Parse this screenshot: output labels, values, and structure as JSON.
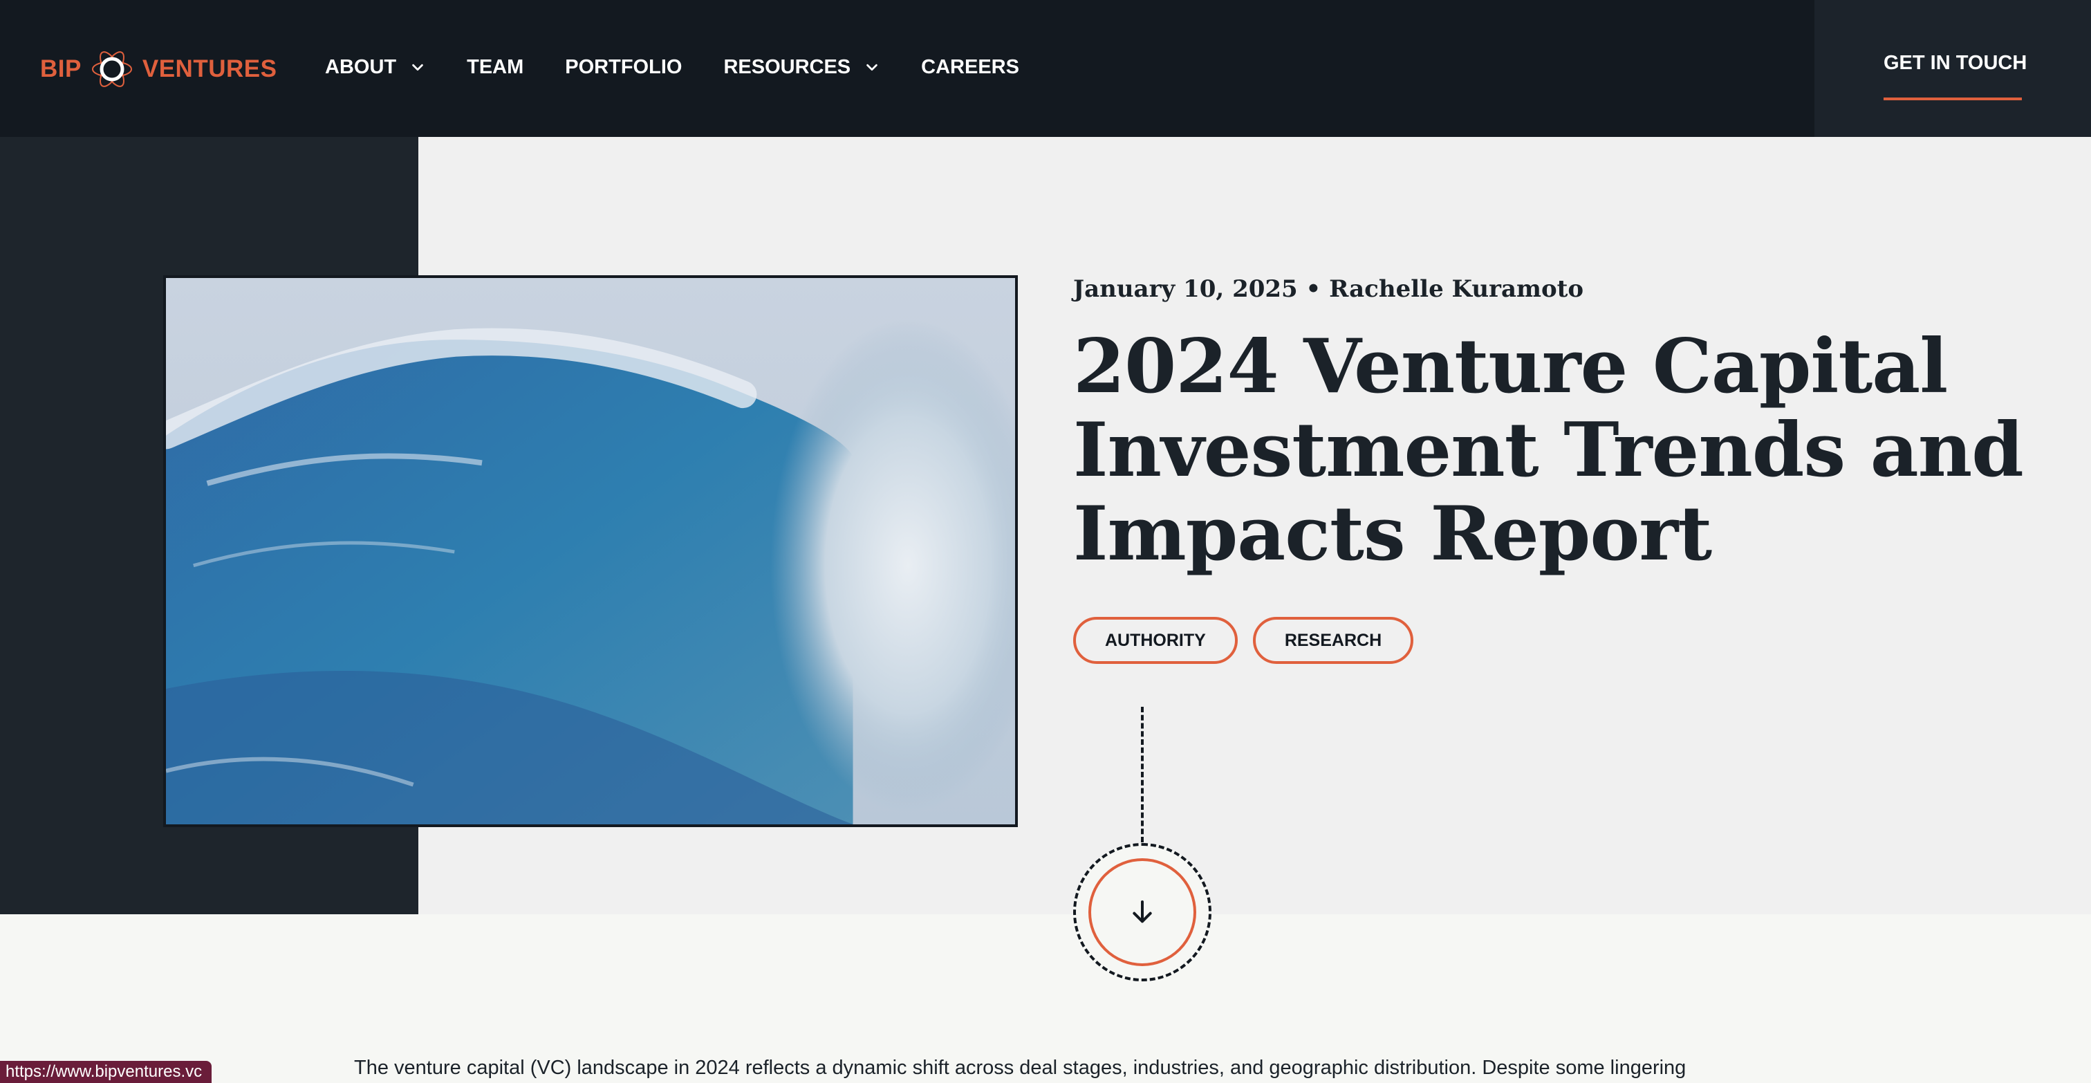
{
  "header": {
    "logo": {
      "left_text": "BIP",
      "right_text": "VENTURES"
    },
    "nav": [
      {
        "label": "ABOUT",
        "has_dropdown": true
      },
      {
        "label": "TEAM",
        "has_dropdown": false
      },
      {
        "label": "PORTFOLIO",
        "has_dropdown": false
      },
      {
        "label": "RESOURCES",
        "has_dropdown": true
      },
      {
        "label": "CAREERS",
        "has_dropdown": false
      }
    ],
    "cta_label": "GET IN TOUCH"
  },
  "hero": {
    "meta": "January 10, 2025 • Rachelle Kuramoto",
    "title": "2024 Venture Capital Investment Trends and Impacts Report",
    "tags": [
      "AUTHORITY",
      "RESEARCH"
    ],
    "image_icon": "ocean-wave-photo",
    "scroll_icon": "arrow-down-icon"
  },
  "body": {
    "intro": "The venture capital (VC) landscape in 2024 reflects a dynamic shift across deal stages, industries, and geographic distribution. Despite some lingering"
  },
  "status_bar": {
    "url": "https://www.bipventures.vc"
  },
  "colors": {
    "accent": "#e0603d",
    "header_bg": "#131920",
    "dark_panel": "#1e252c",
    "hero_bg": "#f0f0f0",
    "text_dark": "#1b2229"
  }
}
